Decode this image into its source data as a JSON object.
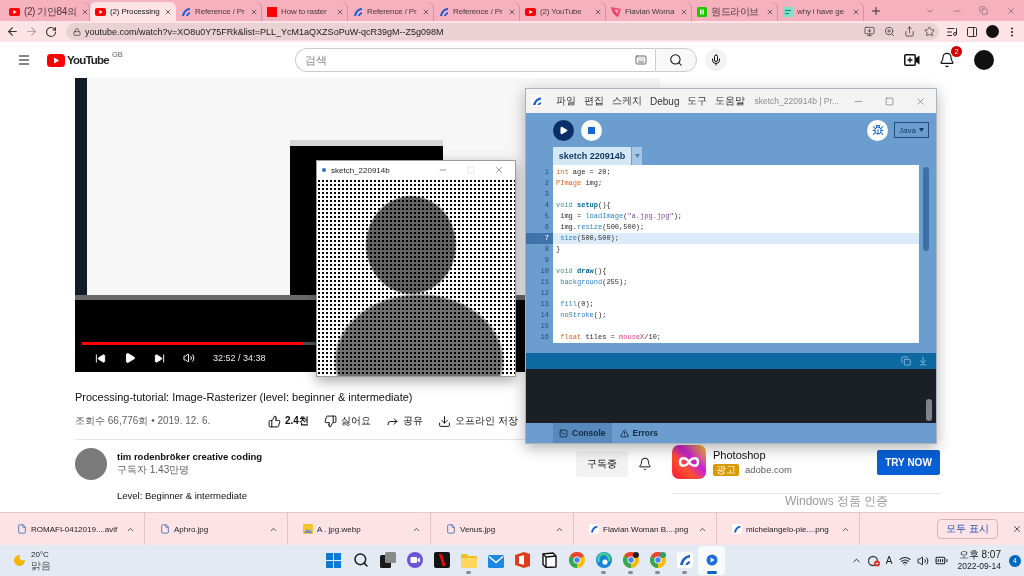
{
  "browser": {
    "tabs": [
      {
        "title": "(2) 기안84의",
        "kind": "play",
        "selected": false
      },
      {
        "title": "(2) Processing",
        "kind": "play",
        "selected": true
      },
      {
        "title": "Reference / Pr",
        "kind": "swoosh",
        "selected": false
      },
      {
        "title": "How to raster",
        "kind": "square",
        "selected": false
      },
      {
        "title": "Reference / Pr",
        "kind": "swoosh",
        "selected": false
      },
      {
        "title": "Reference / Pr",
        "kind": "swoosh",
        "selected": false
      },
      {
        "title": "(2) YouTube",
        "kind": "play",
        "selected": false
      },
      {
        "title": "Flavian Woma",
        "kind": "petal",
        "selected": false
      },
      {
        "title": "원드라이브",
        "kind": "block",
        "selected": false
      },
      {
        "title": "why i have ge",
        "kind": "sheet",
        "selected": false
      }
    ],
    "forward_enabled": false,
    "address": "youtube.com/watch?v=XO8u0Y75FRk&list=PLL_YcM1aQXZSoPuW-qcR39gM--Z5g098M"
  },
  "youtube": {
    "logo": {
      "wordmark": "YouTube",
      "region": "GB"
    },
    "search": {
      "placeholder": "검색"
    },
    "notification_count": "2",
    "player": {
      "progress": {
        "level": 0.95
      },
      "time": "32:52 / 34:38"
    },
    "video": {
      "title": "Processing-tutorial: Image-Rasterizer (level: beginner & intermediate)",
      "stats": "조회수 66,776회 • 2019. 12. 6."
    },
    "actions": [
      {
        "kind": "like",
        "label": "2.4천"
      },
      {
        "kind": "dislike",
        "label": "싫어요"
      },
      {
        "kind": "share",
        "label": "공유"
      },
      {
        "kind": "download",
        "label": "오프라인 저장"
      }
    ],
    "channel": {
      "name": "tim rodenbröker creative coding",
      "subscribers": "구독자 1.43만명",
      "subscribe_button": "구독중"
    },
    "description": "Level: Beginner & intermediate",
    "ad": {
      "title": "Photoshop",
      "badge": "광고",
      "domain": "adobe.com",
      "button": "TRY NOW"
    }
  },
  "processing": {
    "menus": [
      "파일",
      "편집",
      "스케치",
      "Debug",
      "도구",
      "도움말"
    ],
    "title": "sketch_220914b | Pr...",
    "mode": "Java",
    "tab": "sketch 220914b",
    "code": [
      {
        "number": "1",
        "current": false,
        "tokens": [
          {
            "text": "int",
            "kind": "type"
          },
          {
            "text": " age = 20;",
            "kind": "plain"
          }
        ]
      },
      {
        "number": "2",
        "current": false,
        "tokens": [
          {
            "text": "PImage",
            "kind": "type"
          },
          {
            "text": " img;",
            "kind": "plain"
          }
        ]
      },
      {
        "number": "3",
        "current": false
      },
      {
        "number": "4",
        "current": false,
        "tokens": [
          {
            "text": "void ",
            "kind": "keyword"
          },
          {
            "text": "setup",
            "kind": "definition"
          },
          {
            "text": "(){",
            "kind": "plain"
          }
        ]
      },
      {
        "number": "5",
        "current": false,
        "tokens": [
          {
            "text": " img = ",
            "kind": "plain"
          },
          {
            "text": "loadImage",
            "kind": "function"
          },
          {
            "text": "(",
            "kind": "plain"
          },
          {
            "text": "\"a.jpg.jpg\"",
            "kind": "string"
          },
          {
            "text": ");",
            "kind": "plain"
          }
        ]
      },
      {
        "number": "6",
        "current": false,
        "tokens": [
          {
            "text": " img.",
            "kind": "plain"
          },
          {
            "text": "resize",
            "kind": "function"
          },
          {
            "text": "(500,500);",
            "kind": "plain"
          }
        ]
      },
      {
        "number": "7",
        "current": true,
        "tokens": [
          {
            "text": " size",
            "kind": "function"
          },
          {
            "text": "(500,500);",
            "kind": "plain"
          }
        ]
      },
      {
        "number": "8",
        "current": false,
        "tokens": [
          {
            "text": "}",
            "kind": "plain"
          }
        ]
      },
      {
        "number": "9",
        "current": false
      },
      {
        "number": "10",
        "current": false,
        "tokens": [
          {
            "text": "void ",
            "kind": "keyword"
          },
          {
            "text": "draw",
            "kind": "definition"
          },
          {
            "text": "(){",
            "kind": "plain"
          }
        ]
      },
      {
        "number": "11",
        "current": false,
        "tokens": [
          {
            "text": " background",
            "kind": "function"
          },
          {
            "text": "(255);",
            "kind": "plain"
          }
        ]
      },
      {
        "number": "12",
        "current": false
      },
      {
        "number": "13",
        "current": false,
        "tokens": [
          {
            "text": " fill",
            "kind": "function"
          },
          {
            "text": "(0);",
            "kind": "plain"
          }
        ]
      },
      {
        "number": "14",
        "current": false,
        "tokens": [
          {
            "text": " noStroke",
            "kind": "function"
          },
          {
            "text": "();",
            "kind": "plain"
          }
        ]
      },
      {
        "number": "15",
        "current": false
      },
      {
        "number": "16",
        "current": false,
        "tokens": [
          {
            "text": " float",
            "kind": "type"
          },
          {
            "text": " tiles = ",
            "kind": "plain"
          },
          {
            "text": "mouseX",
            "kind": "variable"
          },
          {
            "text": "/10;",
            "kind": "plain"
          }
        ]
      }
    ],
    "console_tabs": [
      {
        "label": "Console",
        "kind": "console",
        "selected": true
      },
      {
        "label": "Errors",
        "kind": "errors",
        "selected": false
      }
    ]
  },
  "sketch_window": {
    "title": "sketch_220914b",
    "maximize_enabled": false
  },
  "activation_notice": "Windows 정품 인증",
  "downloads": {
    "items": [
      {
        "name": "ROMAFI-0412019....avif",
        "kind": "file"
      },
      {
        "name": "Aphro.jpg",
        "kind": "file"
      },
      {
        "name": "A . jpg.webp",
        "kind": "picture"
      },
      {
        "name": "Venus.jpg",
        "kind": "file"
      },
      {
        "name": "Flavian Woman B....png",
        "kind": "swoosh"
      },
      {
        "name": "michelangelo-pie....png",
        "kind": "swoosh"
      }
    ],
    "show_all": "모두 표시"
  },
  "taskbar": {
    "weather": {
      "temperature": "20°C",
      "condition": "맑음"
    },
    "apps": [
      {
        "kind": "start",
        "running": false,
        "selected": false
      },
      {
        "kind": "search",
        "running": false,
        "selected": false
      },
      {
        "kind": "taskview",
        "running": false,
        "selected": false
      },
      {
        "kind": "chat",
        "running": false,
        "selected": false
      },
      {
        "kind": "ribbon",
        "running": false,
        "selected": false
      },
      {
        "kind": "folder",
        "running": true,
        "selected": false
      },
      {
        "kind": "mail",
        "running": false,
        "selected": false
      },
      {
        "kind": "office",
        "running": false,
        "selected": false
      },
      {
        "kind": "cube",
        "running": false,
        "selected": false
      },
      {
        "kind": "wheel",
        "running": false,
        "selected": false
      },
      {
        "kind": "swirl",
        "running": true,
        "selected": false
      },
      {
        "kind": "wheeldot",
        "running": true,
        "selected": false
      },
      {
        "kind": "wheeltag",
        "running": true,
        "selected": false
      },
      {
        "kind": "swoosh",
        "running": true,
        "selected": false
      },
      {
        "kind": "play",
        "running": true,
        "selected": true
      }
    ],
    "input_indicator": "A",
    "clock": {
      "time": "오후 8:07",
      "date": "2022-09-14"
    },
    "notification_count": "4"
  }
}
